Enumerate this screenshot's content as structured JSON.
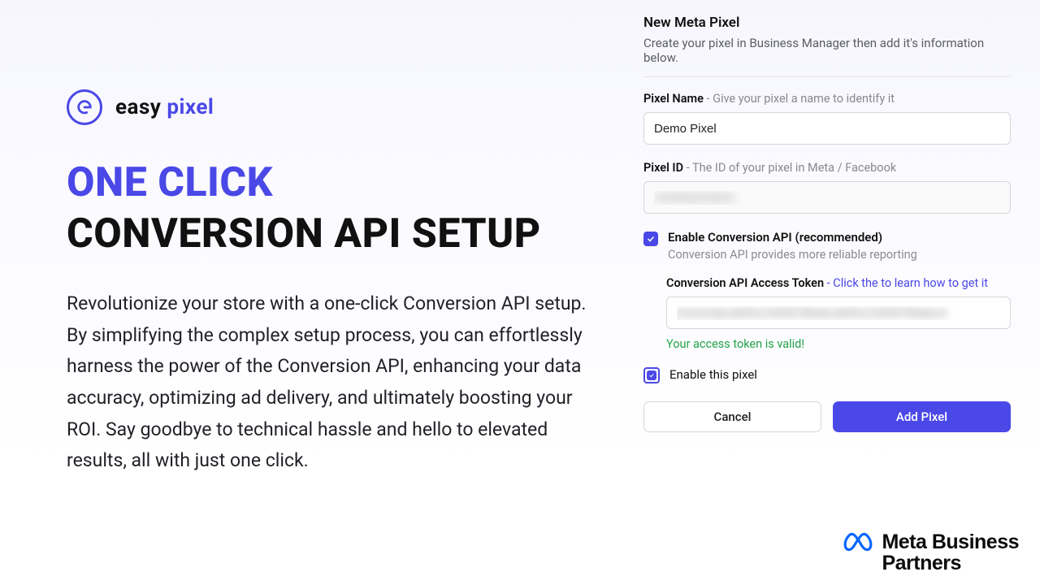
{
  "brand": {
    "name_part1": "easy",
    "name_part2": "pixel"
  },
  "headline": {
    "accent": "ONE CLICK",
    "rest": "CONVERSION API SETUP"
  },
  "body_copy": "Revolutionize your store with a one-click Conversion API setup. By simplifying the complex setup process, you can effortlessly harness the power of the Conversion API, enhancing your data accuracy, optimizing ad delivery, and ultimately boosting your ROI. Say goodbye to technical hassle and hello to elevated results, all with just one click.",
  "form": {
    "title": "New Meta Pixel",
    "subtitle": "Create your pixel in Business Manager then add it's information below.",
    "pixel_name_label": "Pixel Name",
    "pixel_name_hint": " - Give your pixel a name to identify it",
    "pixel_name_value": "Demo Pixel",
    "pixel_id_label": "Pixel ID",
    "pixel_id_hint": " - The ID of your pixel in Meta / Facebook",
    "pixel_id_value": "133442233221",
    "enable_capi_label": "Enable Conversion API (recommended)",
    "enable_capi_sub": "Conversion API provides more reliable reporting",
    "token_label": "Conversion API Access Token",
    "token_hint": " - Click the to learn how to get it",
    "token_value": "EAAGabcdef0123456789abcdef0123456789abcd",
    "token_valid": "Your access token is valid!",
    "enable_pixel_label": "Enable this pixel",
    "cancel": "Cancel",
    "submit": "Add Pixel"
  },
  "meta_badge": {
    "line1": "Meta Business",
    "line2": "Partners"
  }
}
